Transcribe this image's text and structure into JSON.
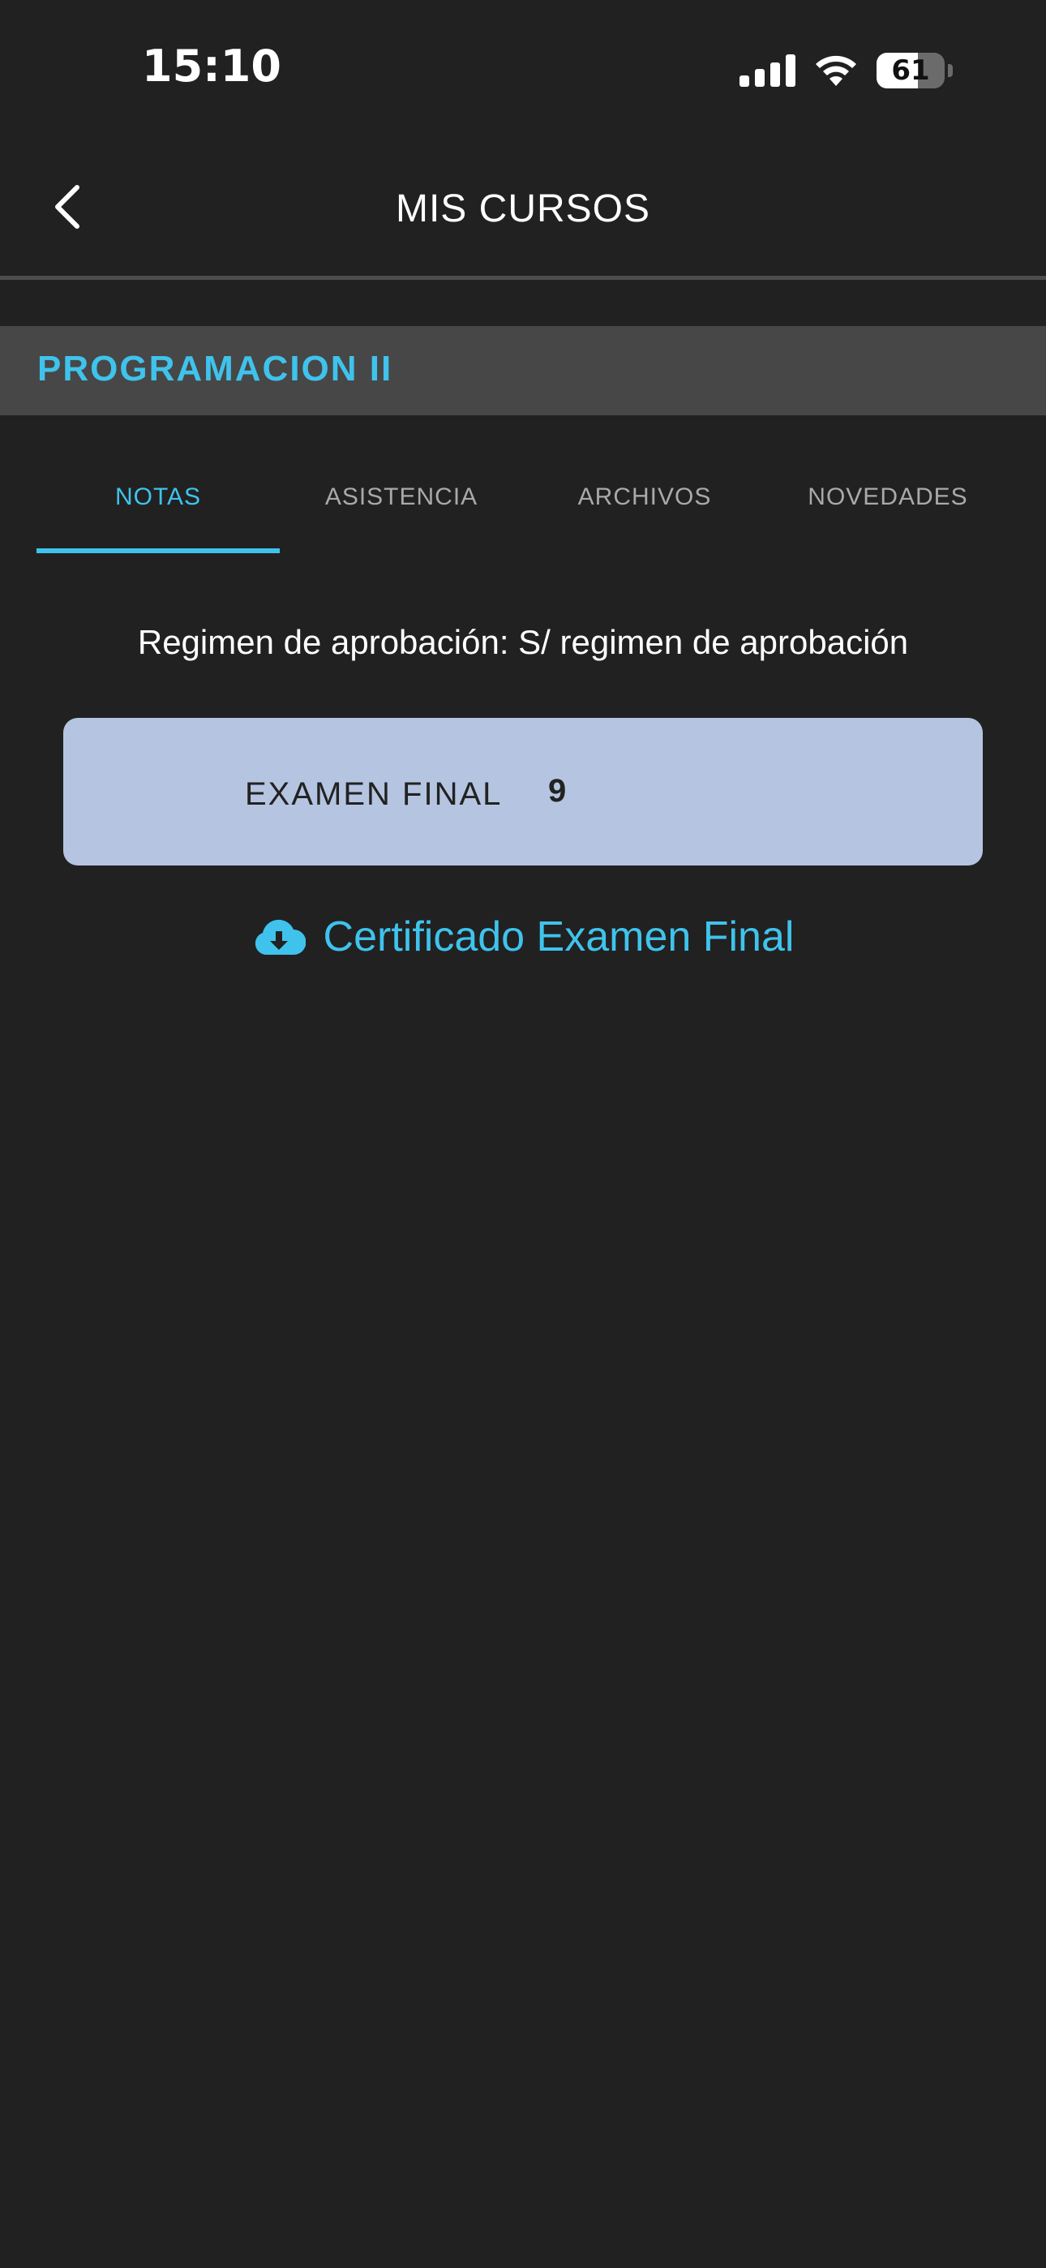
{
  "status_bar": {
    "time": "15:10",
    "battery_percent": 61,
    "battery_label": "61",
    "signal_level": 4,
    "icons": [
      "signal-icon",
      "wifi-icon",
      "battery-icon"
    ]
  },
  "header": {
    "title": "MIS CURSOS",
    "back_icon": "chevron-left-icon"
  },
  "course": {
    "name": "PROGRAMACION II"
  },
  "tabs": [
    {
      "label": "NOTAS",
      "active": true
    },
    {
      "label": "ASISTENCIA",
      "active": false
    },
    {
      "label": "ARCHIVOS",
      "active": false
    },
    {
      "label": "NOVEDADES",
      "active": false
    }
  ],
  "notes": {
    "regimen": "Regimen de aprobación: S/ regimen de aprobación",
    "grades": [
      {
        "label": "EXAMEN FINAL",
        "value": "9"
      }
    ],
    "certificate_label": "Certificado Examen Final",
    "certificate_icon": "cloud-download-icon"
  },
  "colors": {
    "background": "#212121",
    "accent": "#3fc3ec",
    "course_bar": "#474747",
    "grade_card": "#b5c5e1",
    "inactive_tab": "#a9a9a9"
  }
}
